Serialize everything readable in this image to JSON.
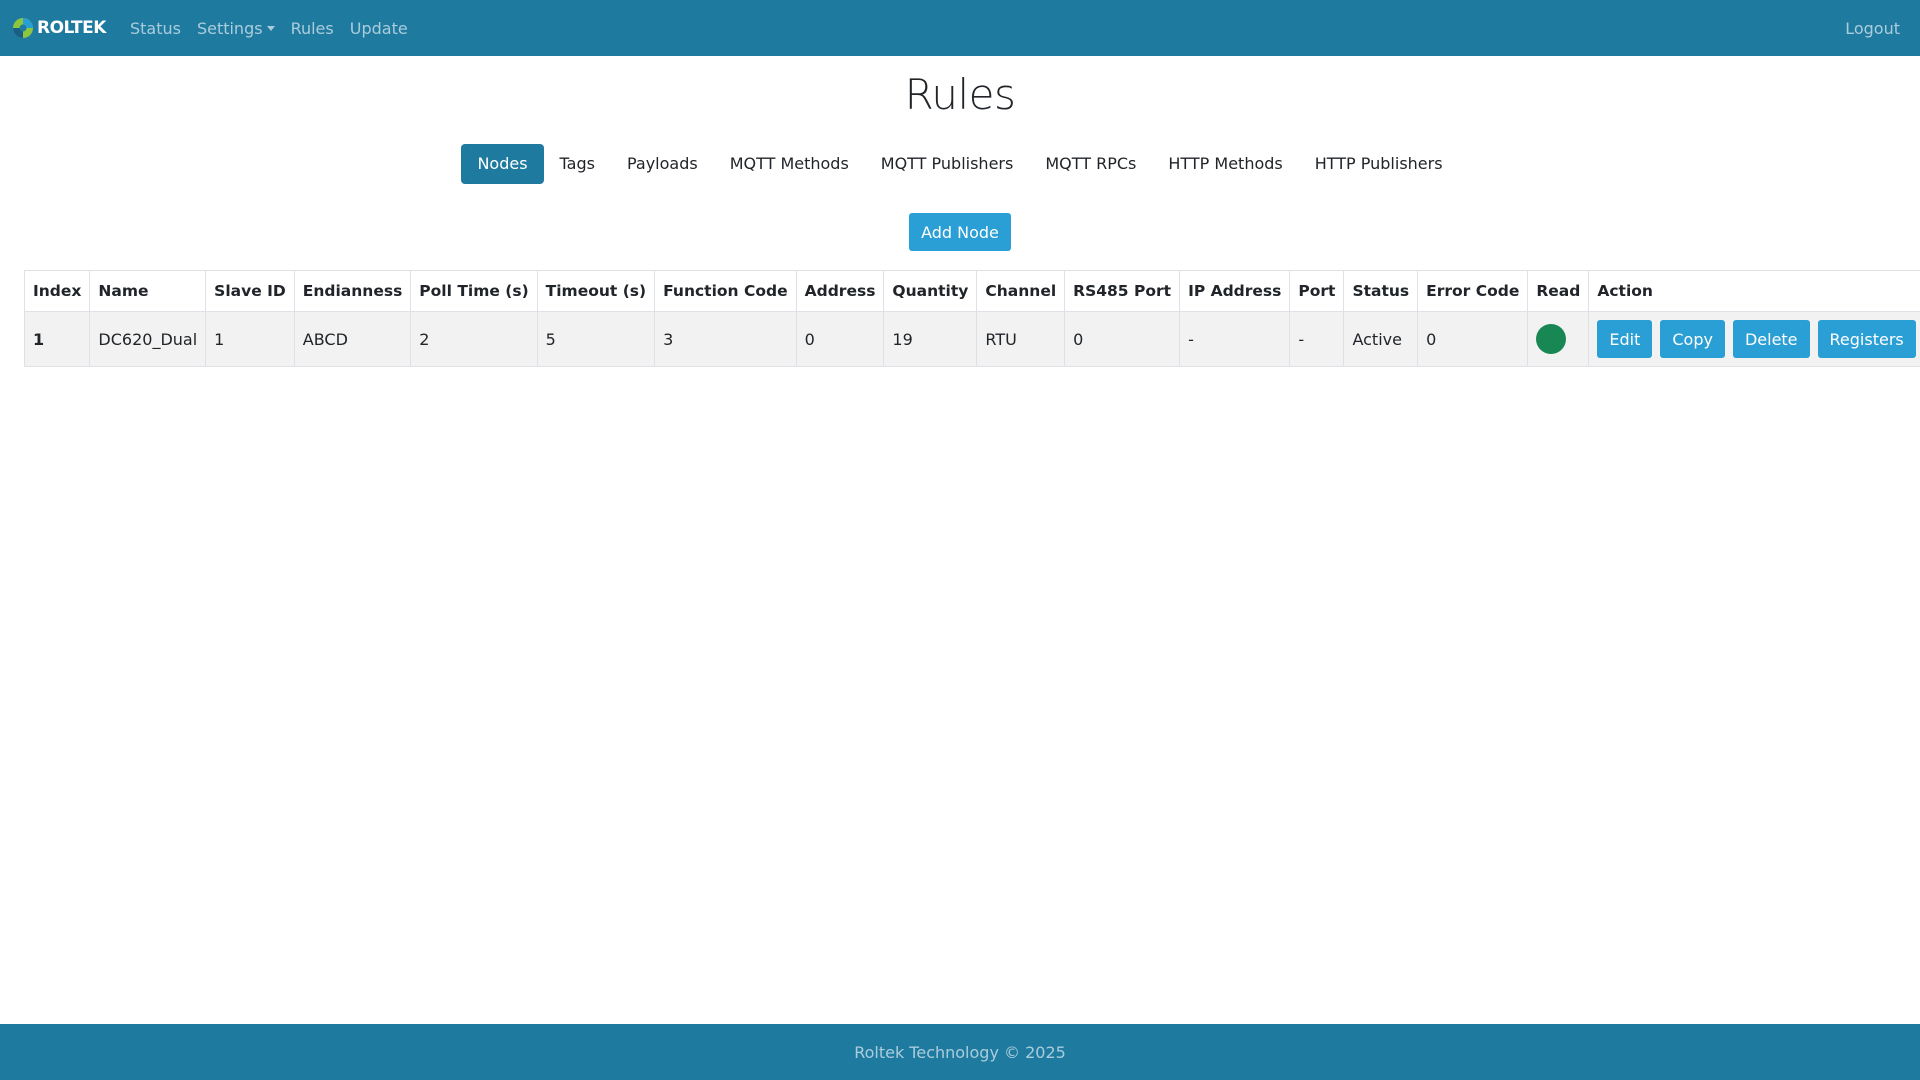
{
  "navbar": {
    "brand": "ROLTEK",
    "links": [
      {
        "label": "Status"
      },
      {
        "label": "Settings",
        "dropdown": true
      },
      {
        "label": "Rules"
      },
      {
        "label": "Update"
      }
    ],
    "logout": "Logout"
  },
  "page": {
    "title": "Rules",
    "tabs": [
      {
        "label": "Nodes",
        "active": true
      },
      {
        "label": "Tags"
      },
      {
        "label": "Payloads"
      },
      {
        "label": "MQTT Methods"
      },
      {
        "label": "MQTT Publishers"
      },
      {
        "label": "MQTT RPCs"
      },
      {
        "label": "HTTP Methods"
      },
      {
        "label": "HTTP Publishers"
      }
    ],
    "add_button": "Add Node"
  },
  "table": {
    "columns": [
      "Index",
      "Name",
      "Slave ID",
      "Endianness",
      "Poll Time (s)",
      "Timeout (s)",
      "Function Code",
      "Address",
      "Quantity",
      "Channel",
      "RS485 Port",
      "IP Address",
      "Port",
      "Status",
      "Error Code",
      "Read",
      "Action"
    ],
    "rows": [
      {
        "index": "1",
        "name": "DC620_Dual",
        "slave_id": "1",
        "endianness": "ABCD",
        "poll_time": "2",
        "timeout": "5",
        "function_code": "3",
        "address": "0",
        "quantity": "19",
        "channel": "RTU",
        "rs485_port": "0",
        "ip_address": "-",
        "port": "-",
        "status": "Active",
        "error_code": "0",
        "read_status": "ok",
        "read_color": "#198754",
        "actions": {
          "edit": "Edit",
          "copy": "Copy",
          "delete": "Delete",
          "registers": "Registers"
        }
      }
    ]
  },
  "footer": {
    "text": "Roltek Technology © 2025"
  },
  "colors": {
    "primary": "#1f7aa0",
    "button": "#2a9fd6",
    "success": "#198754"
  }
}
